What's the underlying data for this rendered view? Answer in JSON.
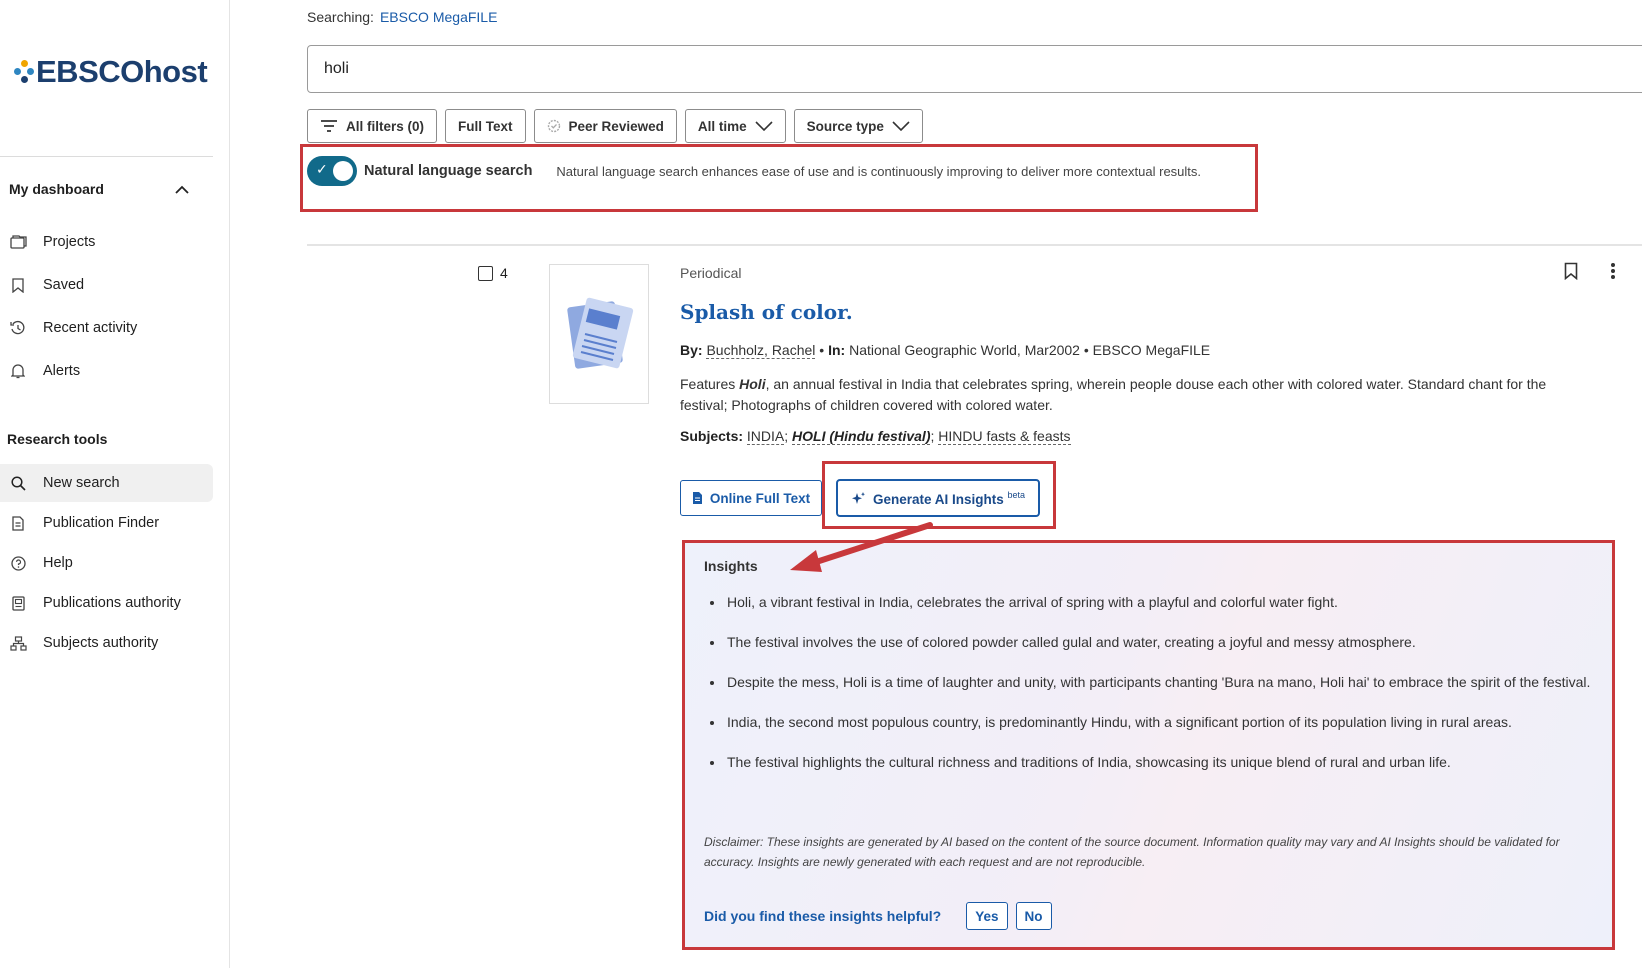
{
  "sidebar": {
    "logo_text": "EBSCOhost",
    "dashboard": {
      "label": "My dashboard"
    },
    "dashboard_items": [
      {
        "label": "Projects",
        "icon": "folders-icon"
      },
      {
        "label": "Saved",
        "icon": "bookmark-icon"
      },
      {
        "label": "Recent activity",
        "icon": "history-icon"
      },
      {
        "label": "Alerts",
        "icon": "bell-icon"
      }
    ],
    "research_tools_label": "Research tools",
    "research_items": [
      {
        "label": "New search",
        "icon": "search-icon"
      },
      {
        "label": "Publication Finder",
        "icon": "document-icon"
      },
      {
        "label": "Help",
        "icon": "help-icon"
      },
      {
        "label": "Publications authority",
        "icon": "book-icon"
      },
      {
        "label": "Subjects authority",
        "icon": "hierarchy-icon"
      }
    ]
  },
  "search": {
    "searching_label": "Searching:",
    "database": "EBSCO MegaFILE",
    "query": "holi"
  },
  "filters": {
    "all_filters": "All filters (0)",
    "full_text": "Full Text",
    "peer_reviewed": "Peer Reviewed",
    "all_time": "All time",
    "source_type": "Source type"
  },
  "natural_language": {
    "label": "Natural language search",
    "description": "Natural language search enhances ease of use and is continuously improving to deliver more contextual results."
  },
  "result": {
    "number": "4",
    "type": "Periodical",
    "title": "Splash of color.",
    "by_label": "By:",
    "author": "Buchholz, Rachel",
    "in_label": "In:",
    "source": "National Geographic World, Mar2002",
    "database": "EBSCO MegaFILE",
    "desc_prefix": "Features ",
    "desc_term": "Holi",
    "desc_rest": ", an annual festival in India that celebrates spring, wherein people douse each other with colored water. Standard chant for the festival; Photographs of children covered with colored water.",
    "subjects_label": "Subjects:",
    "subjects": [
      "INDIA",
      "HOLI (Hindu festival)",
      "HINDU fasts & feasts"
    ],
    "online_full_text": "Online Full Text",
    "generate_ai": "Generate AI Insights",
    "beta": "beta"
  },
  "insights": {
    "title": "Insights",
    "bullets": [
      "Holi, a vibrant festival in India, celebrates the arrival of spring with a playful and colorful water fight.",
      "The festival involves the use of colored powder called gulal and water, creating a joyful and messy atmosphere.",
      "Despite the mess, Holi is a time of laughter and unity, with participants chanting 'Bura na mano, Holi hai' to embrace the spirit of the festival.",
      "India, the second most populous country, is predominantly Hindu, with a significant portion of its population living in rural areas.",
      "The festival highlights the cultural richness and traditions of India, showcasing its unique blend of rural and urban life."
    ],
    "disclaimer": "Disclaimer: These insights are generated by AI based on the content of the source document. Information quality may vary and AI Insights should be validated for accuracy. Insights are newly generated with each request and are not reproducible.",
    "helpful_question": "Did you find these insights helpful?",
    "yes": "Yes",
    "no": "No"
  },
  "colors": {
    "brand_blue": "#1a5ba8",
    "toggle_teal": "#116a8a",
    "annotation_red": "#c8383b"
  }
}
